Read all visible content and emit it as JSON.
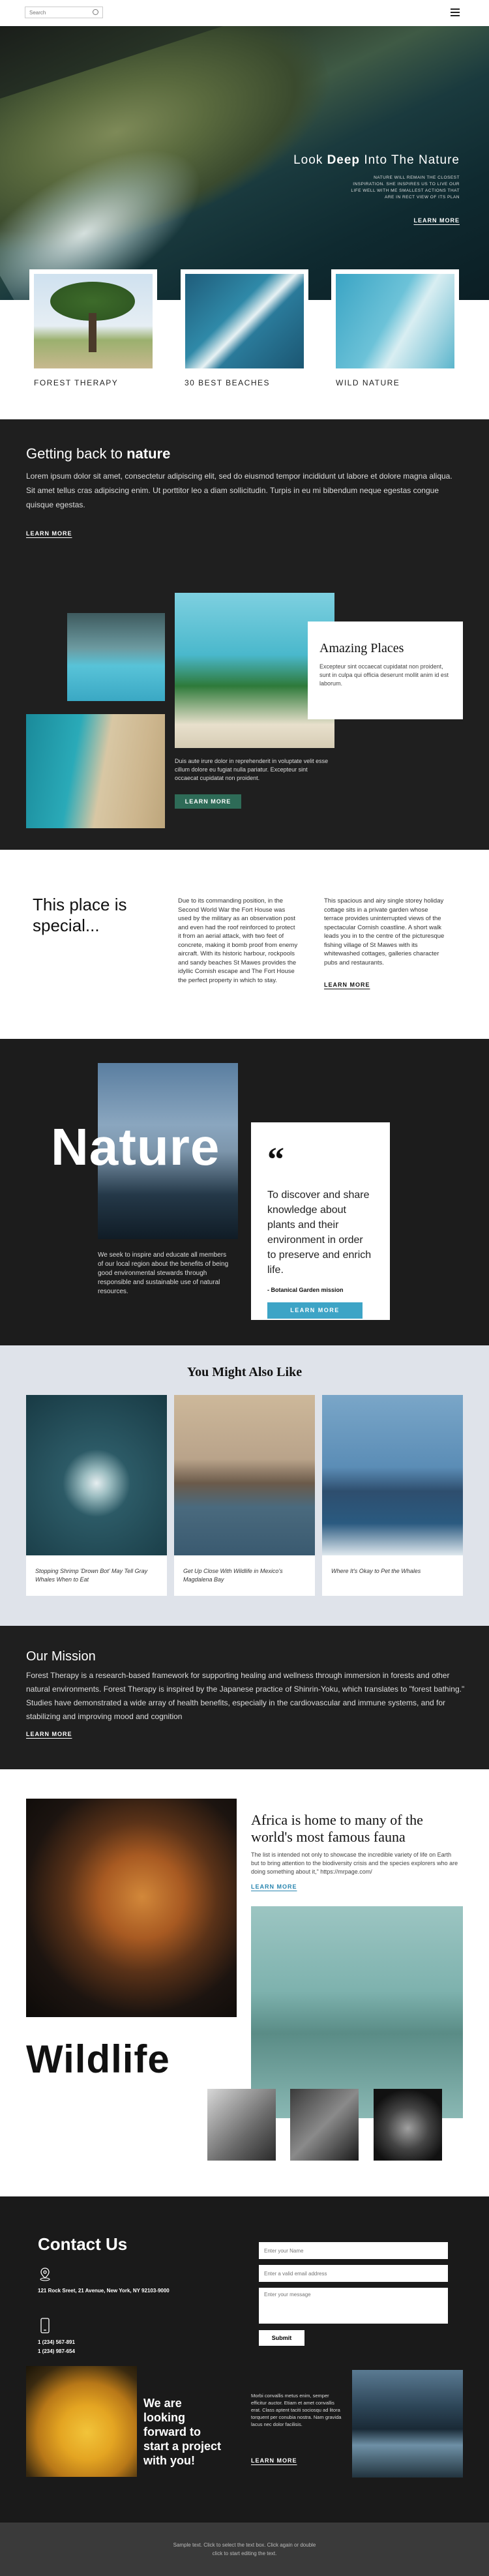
{
  "header": {
    "search_placeholder": "Search",
    "search_icon": "search-icon",
    "menu_icon": "hamburger-menu-icon"
  },
  "hero": {
    "title_pre": "Look ",
    "title_bold": "Deep",
    "title_post": " Into The Nature",
    "text": "NATURE WILL REMAIN THE CLOSEST INSPIRATION. SHE INSPIRES US TO LIVE OUR LIFE WELL WITH ME SMALLEST ACTIONS THAT ARE IN RECT VIEW OF ITS PLAN",
    "link": "LEARN MORE"
  },
  "cards": [
    {
      "label": "FOREST THERAPY"
    },
    {
      "label": "30 BEST BEACHES"
    },
    {
      "label": "WILD NATURE"
    }
  ],
  "intro": {
    "title_pre": "Getting back to ",
    "title_bold": "nature",
    "text": "Lorem ipsum dolor sit amet, consectetur adipiscing elit, sed do eiusmod tempor incididunt ut labore et dolore magna aliqua. Sit amet tellus cras adipiscing enim. Ut porttitor leo a diam sollicitudin. Turpis in eu mi bibendum neque egestas congue quisque egestas.",
    "link": "LEARN MORE"
  },
  "amazing": {
    "title": "Amazing Places",
    "text": "Excepteur sint occaecat cupidatat non proident, sunt in culpa qui officia deserunt mollit anim id est laborum.",
    "caption": "Duis aute irure dolor in reprehenderit in voluptate velit esse cillum dolore eu fugiat nulla pariatur. Excepteur sint occaecat cupidatat non proident.",
    "button": "LEARN MORE"
  },
  "special": {
    "title_line1": "This place is",
    "title_line2": "special...",
    "col1": "Due to its commanding position, in the Second World War the Fort House was used by the military as an observation post and even had the roof reinforced to protect it from an aerial attack, with two feet of concrete, making it bomb proof from enemy aircraft. With its historic harbour, rockpools and sandy beaches St Mawes provides the idyllic Cornish escape and The Fort House the perfect property in which to stay.",
    "col2": "This spacious and airy single storey holiday cottage sits in a private garden whose terrace provides uninterrupted views of the spectacular Cornish coastline. A short walk leads you in to the centre of the picturesque fishing village of St Mawes with its whitewashed cottages, galleries character pubs and restaurants.",
    "link": "LEARN MORE"
  },
  "nature": {
    "title": "Nature",
    "text": "We seek to inspire and educate all members of our local region about the benefits of being good environmental stewards through responsible and sustainable use of natural resources.",
    "quote": "To discover and share knowledge about plants and their environment in order to preserve and enrich life.",
    "source": "- Botanical Garden mission",
    "button": "LEARN MORE"
  },
  "like": {
    "title": "You Might Also Like",
    "items": [
      {
        "caption": "Stopping Shrimp 'Drown Bot' May Tell Gray Whales When to Eat"
      },
      {
        "caption": "Get Up Close With Wildlife in Mexico's Magdalena Bay"
      },
      {
        "caption": "Where It's Okay to Pet the Whales"
      }
    ]
  },
  "mission": {
    "title": "Our Mission",
    "text": "Forest Therapy is a research-based framework for supporting healing and wellness through immersion in forests and other natural environments. Forest Therapy is inspired by the Japanese practice of Shinrin-Yoku, which translates to \"forest bathing.\" Studies have demonstrated a wide array of health benefits, especially in the cardiovascular and immune systems, and for stabilizing and improving mood and cognition",
    "link": "LEARN MORE"
  },
  "wildlife": {
    "heading": "Africa is home to many of the world's most famous fauna",
    "text": "The list is intended not only to showcase the incredible variety of life on Earth but to bring attention to the biodiversity crisis and the species explorers who are doing something about it,\" https://mrpage.com/",
    "link": "LEARN MORE",
    "title": "Wildlife"
  },
  "contact": {
    "title": "Contact Us",
    "address": "121 Rock Sreet, 21 Avenue, New York, NY 92103-9000",
    "phone1": "1 (234) 567-891",
    "phone2": "1 (234) 987-654",
    "name_placeholder": "Enter your Name",
    "email_placeholder": "Enter a valid email address",
    "message_placeholder": "Enter your message",
    "submit": "Submit",
    "start_line1": "We are",
    "start_line2": "looking",
    "start_line3": "forward to",
    "start_line4": "start a project",
    "start_line5": "with you!",
    "paragraph": "Morbi convallis metus enim, semper efficitur auctor. Etiam et amet convallis erat. Class aptent taciti sociosqu ad litora torquent per conubia nostra. Nam gravida lacus nec dolor facilisis.",
    "link": "LEARN MORE"
  },
  "footer": {
    "line1": "Sample text. Click to select the text box. Click again or double",
    "line2": "click to start editing the text."
  }
}
